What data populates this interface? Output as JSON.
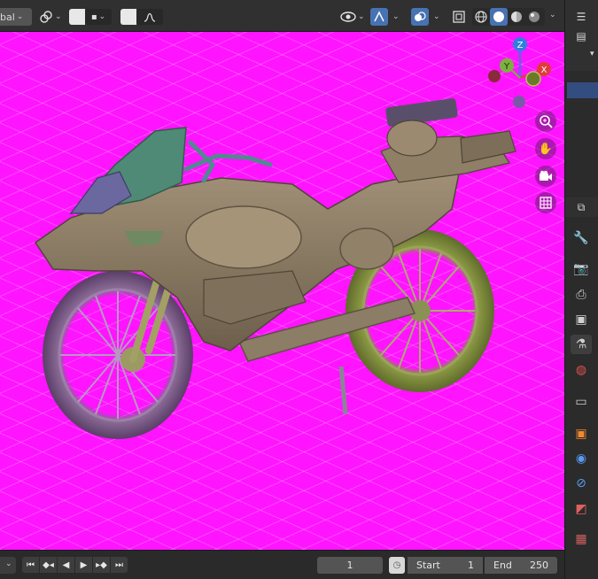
{
  "header": {
    "transform_orientation": "bal",
    "snap_icon": "magnet-icon",
    "proportional_icon": "proportional-falloff-icon",
    "viewport_shading_modes": [
      "wireframe",
      "solid",
      "material",
      "rendered"
    ]
  },
  "gizmo": {
    "axis_x": "X",
    "axis_y": "Y",
    "axis_z": "Z"
  },
  "timeline": {
    "current_frame": "1",
    "start_label": "Start",
    "start_value": "1",
    "end_label": "End",
    "end_value": "250"
  },
  "right_panel": {
    "tabs": [
      "tool",
      "render",
      "output",
      "view-layer",
      "scene",
      "world",
      "collection",
      "object",
      "modifiers",
      "particles",
      "physics",
      "object-constraints",
      "object-data",
      "material",
      "texture"
    ]
  },
  "colors": {
    "viewport_bg": "#ff14ff",
    "panel_bg": "#303030",
    "accent_blue": "#4772b3"
  }
}
